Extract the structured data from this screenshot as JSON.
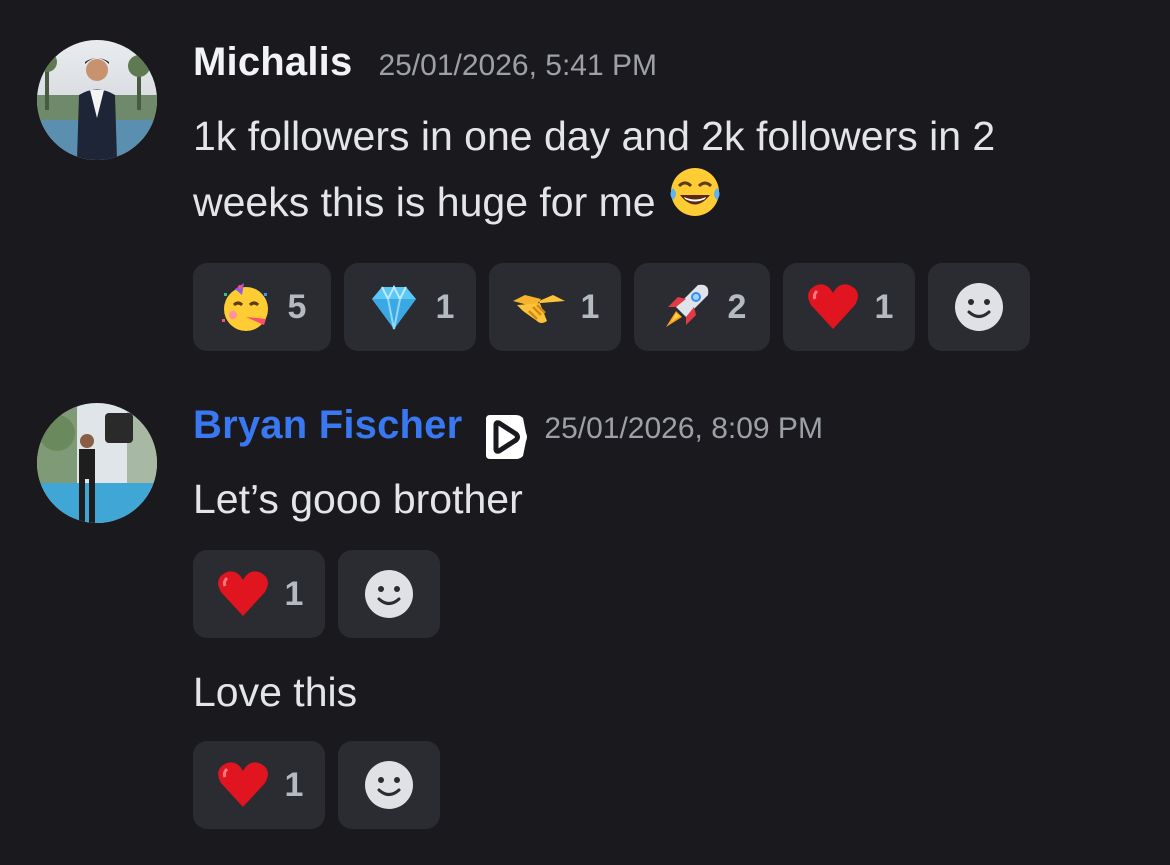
{
  "messages": [
    {
      "username": "Michalis",
      "timestamp": "25/01/2026, 5:41 PM",
      "text": "1k followers in one day and 2k followers in 2",
      "text_line2": "weeks this is huge for me",
      "text_emoji": "face-with-tears-of-joy-icon",
      "reactions": [
        {
          "emoji": "partying-face-icon",
          "count": "5"
        },
        {
          "emoji": "gem-stone-icon",
          "count": "1"
        },
        {
          "emoji": "handshake-icon",
          "count": "1"
        },
        {
          "emoji": "rocket-icon",
          "count": "2"
        },
        {
          "emoji": "red-heart-icon",
          "count": "1"
        }
      ]
    },
    {
      "username": "Bryan Fischer",
      "username_color": "#3a78f2",
      "badge": "play-badge-icon",
      "timestamp": "25/01/2026, 8:09 PM",
      "text": "Let’s gooo brother",
      "reactions": [
        {
          "emoji": "red-heart-icon",
          "count": "1"
        }
      ]
    },
    {
      "text": "Love this",
      "reactions": [
        {
          "emoji": "red-heart-icon",
          "count": "1"
        }
      ]
    }
  ],
  "colors": {
    "background": "#1a1a1e",
    "reaction_bg": "#2b2c31",
    "username_default": "#f2f3f5",
    "timestamp": "#9da0a6"
  }
}
